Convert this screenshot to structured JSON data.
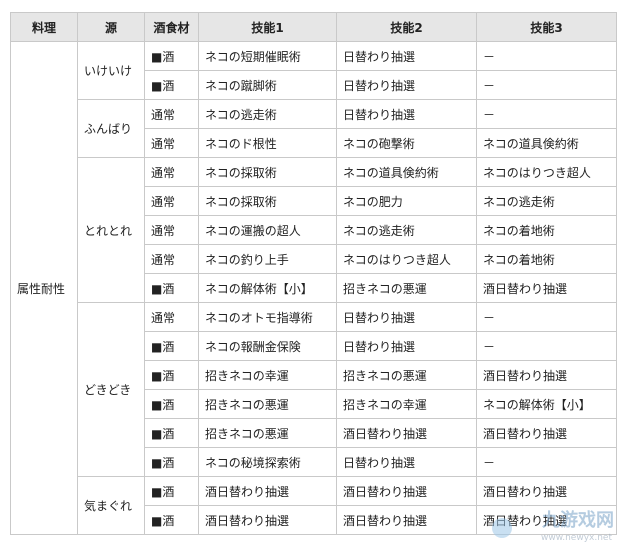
{
  "headers": [
    "料理",
    "源",
    "酒食材",
    "技能1",
    "技能2",
    "技能3"
  ],
  "attribute_label": "属性耐性",
  "groups": [
    {
      "source": "いけいけ",
      "rows": [
        [
          "■酒",
          "ネコの短期催眠術",
          "日替わり抽選",
          "－"
        ],
        [
          "■酒",
          "ネコの蹴脚術",
          "日替わり抽選",
          "－"
        ]
      ]
    },
    {
      "source": "ふんばり",
      "rows": [
        [
          "通常",
          "ネコの逃走術",
          "日替わり抽選",
          "－"
        ],
        [
          "通常",
          "ネコのド根性",
          "ネコの砲撃術",
          "ネコの道具倹約術"
        ]
      ]
    },
    {
      "source": "とれとれ",
      "rows": [
        [
          "通常",
          "ネコの採取術",
          "ネコの道具倹約術",
          "ネコのはりつき超人"
        ],
        [
          "通常",
          "ネコの採取術",
          "ネコの肥力",
          "ネコの逃走術"
        ],
        [
          "通常",
          "ネコの運搬の超人",
          "ネコの逃走術",
          "ネコの着地術"
        ],
        [
          "通常",
          "ネコの釣り上手",
          "ネコのはりつき超人",
          "ネコの着地術"
        ],
        [
          "■酒",
          "ネコの解体術【小】",
          "招きネコの悪運",
          "酒日替わり抽選"
        ]
      ]
    },
    {
      "source": "どきどき",
      "rows": [
        [
          "通常",
          "ネコのオトモ指導術",
          "日替わり抽選",
          "－"
        ],
        [
          "■酒",
          "ネコの報酬金保険",
          "日替わり抽選",
          "－"
        ],
        [
          "■酒",
          "招きネコの幸運",
          "招きネコの悪運",
          "酒日替わり抽選"
        ],
        [
          "■酒",
          "招きネコの悪運",
          "招きネコの幸運",
          "ネコの解体術【小】"
        ],
        [
          "■酒",
          "招きネコの悪運",
          "酒日替わり抽選",
          "酒日替わり抽選"
        ],
        [
          "■酒",
          "ネコの秘境探索術",
          "日替わり抽選",
          "－"
        ]
      ]
    },
    {
      "source": "気まぐれ",
      "rows": [
        [
          "■酒",
          "酒日替わり抽選",
          "酒日替わり抽選",
          "酒日替わり抽選"
        ],
        [
          "■酒",
          "酒日替わり抽選",
          "酒日替わり抽選",
          "酒日替わり抽選"
        ]
      ]
    }
  ],
  "watermark": {
    "text": "九游戏网",
    "url": "www.newyx.net"
  }
}
